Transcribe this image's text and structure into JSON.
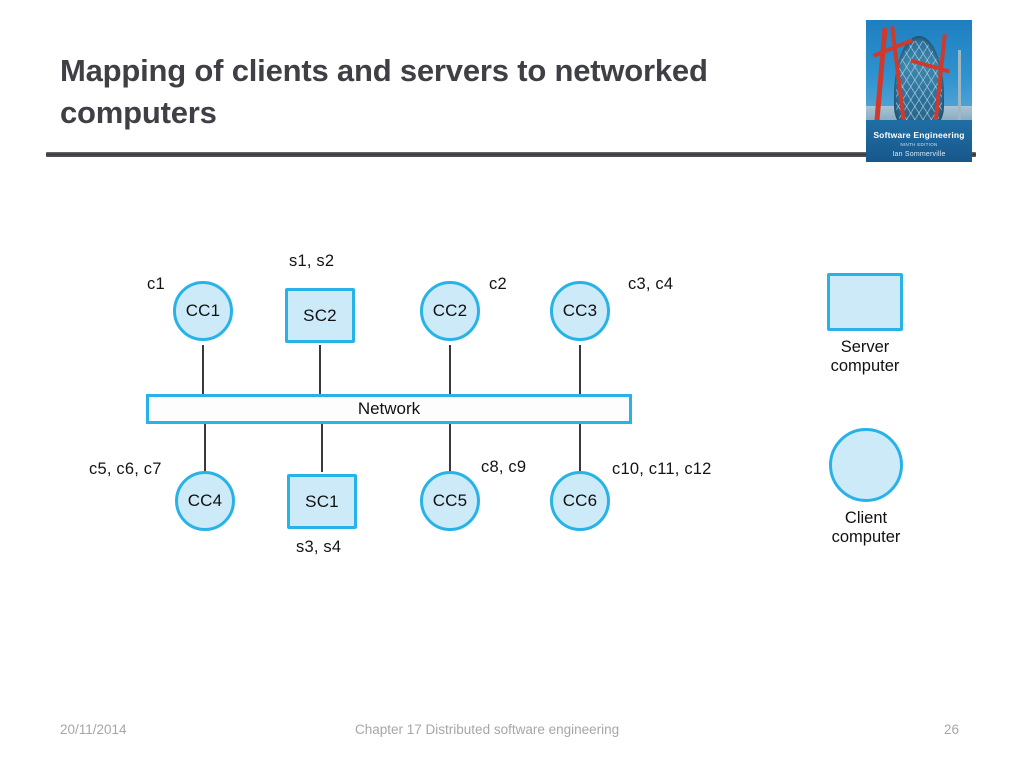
{
  "slide": {
    "title": "Mapping of clients and servers to networked\ncomputers"
  },
  "book_cover": {
    "title": "Software Engineering",
    "edition": "NINTH EDITION",
    "author": "Ian Sommerville"
  },
  "diagram": {
    "network_label": "Network",
    "top_nodes": [
      {
        "id": "CC1",
        "shape": "circle",
        "tag": "c1",
        "tag_position": "left"
      },
      {
        "id": "SC2",
        "shape": "square",
        "tag": "s1, s2",
        "tag_position": "above"
      },
      {
        "id": "CC2",
        "shape": "circle",
        "tag": "c2",
        "tag_position": "right"
      },
      {
        "id": "CC3",
        "shape": "circle",
        "tag": "c3, c4",
        "tag_position": "right"
      }
    ],
    "bottom_nodes": [
      {
        "id": "CC4",
        "shape": "circle",
        "tag": "c5, c6, c7",
        "tag_position": "left"
      },
      {
        "id": "SC1",
        "shape": "square",
        "tag": "s3, s4",
        "tag_position": "below"
      },
      {
        "id": "CC5",
        "shape": "circle",
        "tag": "c8, c9",
        "tag_position": "right"
      },
      {
        "id": "CC6",
        "shape": "circle",
        "tag": "c10, c11, c12",
        "tag_position": "right"
      }
    ]
  },
  "legend": {
    "server": "Server\ncomputer",
    "client": "Client\ncomputer"
  },
  "footer": {
    "date": "20/11/2014",
    "chapter": "Chapter 17 Distributed software engineering",
    "page": "26"
  },
  "colors": {
    "node_fill": "#cdeaf8",
    "node_border": "#27b3e8",
    "title_text": "#3f3f46",
    "connector": "#3a3a3a",
    "footer_text": "#a6a6a6"
  }
}
